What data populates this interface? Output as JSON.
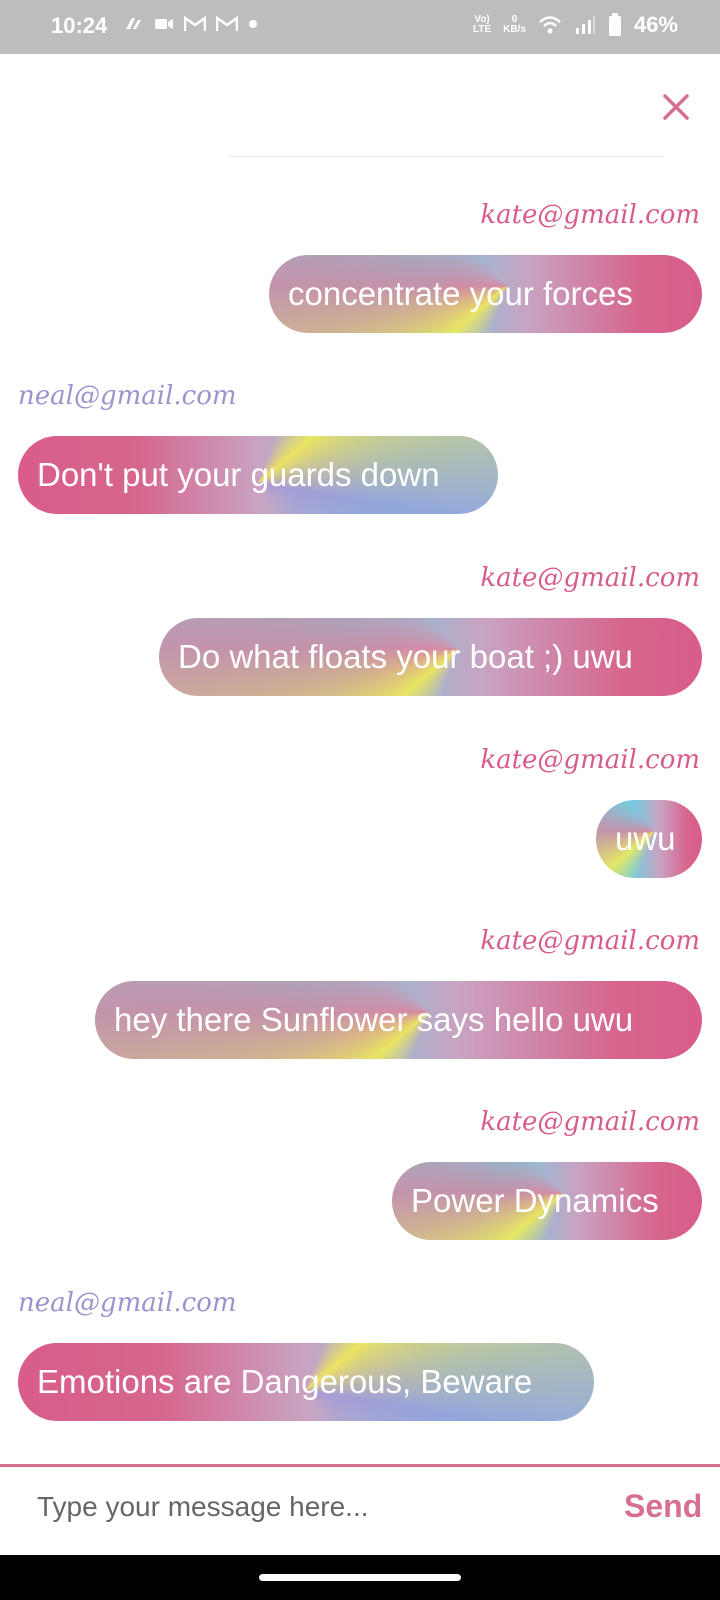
{
  "status_bar": {
    "time": "10:24",
    "battery": "46%",
    "network": "LTE",
    "speed_value": "0",
    "speed_unit": "KB/s"
  },
  "messages": [
    {
      "sender": "kate@gmail.com",
      "text": "concentrate your forces",
      "direction": "outgoing"
    },
    {
      "sender": "neal@gmail.com",
      "text": "Don't put your guards down",
      "direction": "incoming"
    },
    {
      "sender": "kate@gmail.com",
      "text": "Do what floats your boat ;) uwu",
      "direction": "outgoing"
    },
    {
      "sender": "kate@gmail.com",
      "text": "uwu",
      "direction": "outgoing"
    },
    {
      "sender": "kate@gmail.com",
      "text": "hey there Sunflower says hello uwu",
      "direction": "outgoing"
    },
    {
      "sender": "kate@gmail.com",
      "text": "Power Dynamics",
      "direction": "outgoing"
    },
    {
      "sender": "neal@gmail.com",
      "text": "Emotions are Dangerous, Beware",
      "direction": "incoming"
    }
  ],
  "composer": {
    "placeholder": "Type your message here...",
    "send_label": "Send"
  },
  "colors": {
    "accent": "#d7708f",
    "outgoing_sender": "#d85c8a",
    "incoming_sender": "#9c93cf",
    "bubble_cyan": "#6fd3e9",
    "bubble_pink": "#d95c8a"
  }
}
